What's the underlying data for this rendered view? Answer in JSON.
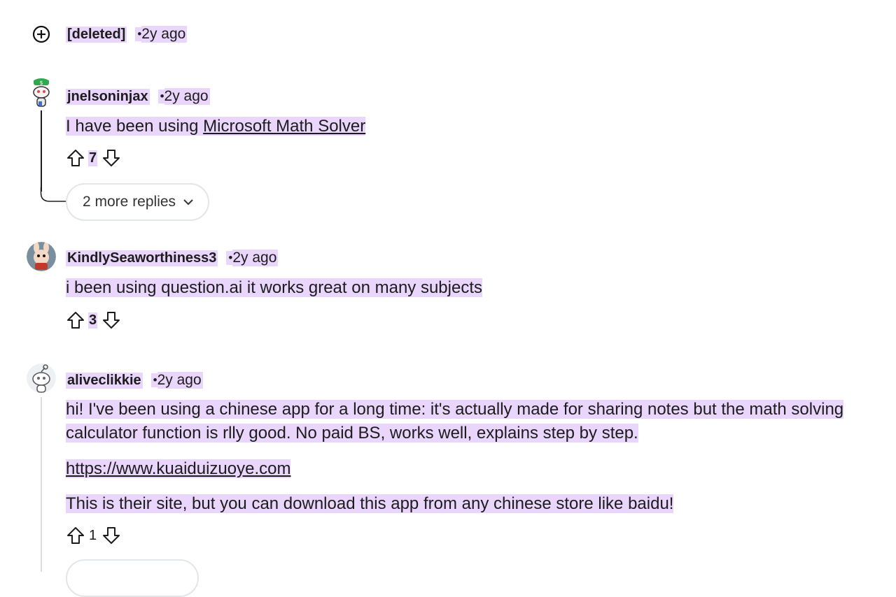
{
  "comments": [
    {
      "author": "[deleted]",
      "time": "2y ago",
      "collapse_icon": "expand-plus-icon"
    },
    {
      "author": "jnelsoninjax",
      "time": "2y ago",
      "avatar_icon": "snoo-avatar-green-hat",
      "body_prefix": "I have been using ",
      "body_link": "Microsoft Math Solver",
      "score": "7",
      "more_replies": "2 more replies"
    },
    {
      "author": "KindlySeaworthiness3",
      "time": "2y ago",
      "avatar_icon": "snoo-avatar-bunny",
      "body": "i been using question.ai it works great on many subjects",
      "score": "3"
    },
    {
      "author": "aliveclikkie",
      "time": "2y ago",
      "avatar_icon": "snoo-avatar-default",
      "body_line1": "hi! I've been using a chinese app for a long time: it's actually made for sharing notes but the math solving",
      "body_line2": "calculator function is rlly good. No paid BS, works well, explains step by step.",
      "link": "https://www.kuaiduizuoye.com",
      "body_line3": "This is their site, but you can download this app from any chinese store like baidu!",
      "score": "1"
    }
  ],
  "colors": {
    "highlight": "#ead6fc",
    "thread_line": "#dcdcdc",
    "button_border": "#e3e6e8"
  }
}
